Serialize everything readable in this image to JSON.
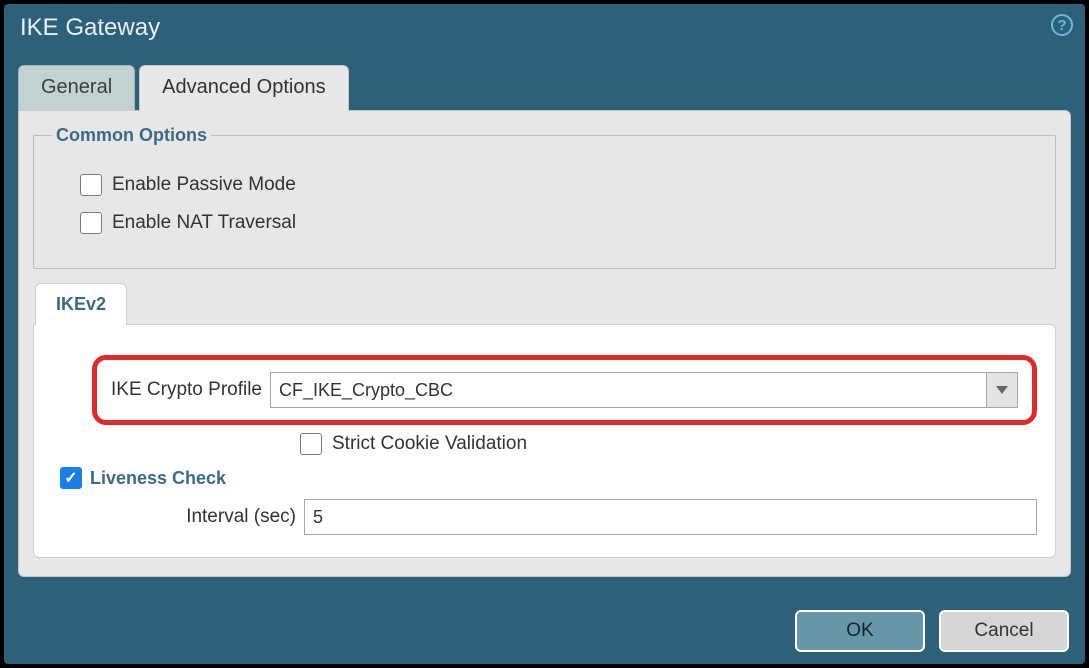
{
  "window": {
    "title": "IKE Gateway"
  },
  "tabs": {
    "general": "General",
    "advanced": "Advanced Options"
  },
  "common": {
    "legend": "Common Options",
    "passive": "Enable Passive Mode",
    "nat": "Enable NAT Traversal"
  },
  "ikev2": {
    "tab": "IKEv2",
    "crypto_label": "IKE Crypto Profile",
    "crypto_value": "CF_IKE_Crypto_CBC",
    "strict": "Strict Cookie Validation",
    "liveness_label": "Liveness Check",
    "interval_label": "Interval (sec)",
    "interval_value": "5"
  },
  "buttons": {
    "ok": "OK",
    "cancel": "Cancel"
  }
}
